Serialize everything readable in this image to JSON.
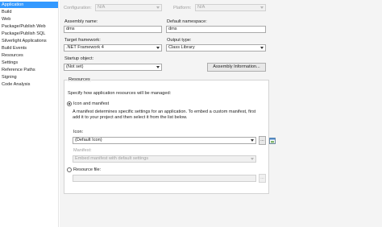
{
  "sidebar": {
    "items": [
      {
        "label": "Application"
      },
      {
        "label": "Build"
      },
      {
        "label": "Web"
      },
      {
        "label": "Package/Publish Web"
      },
      {
        "label": "Package/Publish SQL"
      },
      {
        "label": "Silverlight Applications"
      },
      {
        "label": "Build Events"
      },
      {
        "label": "Resources"
      },
      {
        "label": "Settings"
      },
      {
        "label": "Reference Paths"
      },
      {
        "label": "Signing"
      },
      {
        "label": "Code Analysis"
      }
    ]
  },
  "config": {
    "configuration_label": "Configuration:",
    "configuration_value": "N/A",
    "platform_label": "Platform:",
    "platform_value": "N/A"
  },
  "assembly": {
    "name_label": "Assembly name:",
    "name_value": "dms",
    "namespace_label": "Default namespace:",
    "namespace_value": "dms"
  },
  "target": {
    "framework_label": "Target framework:",
    "framework_value": ".NET Framework 4",
    "output_label": "Output type:",
    "output_value": "Class Library"
  },
  "startup": {
    "label": "Startup object:",
    "value": "(Not set)"
  },
  "buttons": {
    "assembly_info": "Assembly Information...",
    "browse": "..."
  },
  "resources": {
    "title": "Resources",
    "description": "Specify how application resources will be managed:",
    "option_icon_manifest": "Icon and manifest",
    "help_text_line1": "A manifest determines specific settings for an application. To embed a custom manifest, first",
    "help_text_line2": "add it to your project and then select it from the list below.",
    "icon_label": "Icon:",
    "icon_value": "(Default Icon)",
    "manifest_label": "Manifest:",
    "manifest_value": "Embed manifest with default settings",
    "option_resource_file": "Resource file:",
    "resource_file_value": ""
  },
  "colors": {
    "selection": "#3399ff",
    "panel_background": "#f4f4f4"
  }
}
